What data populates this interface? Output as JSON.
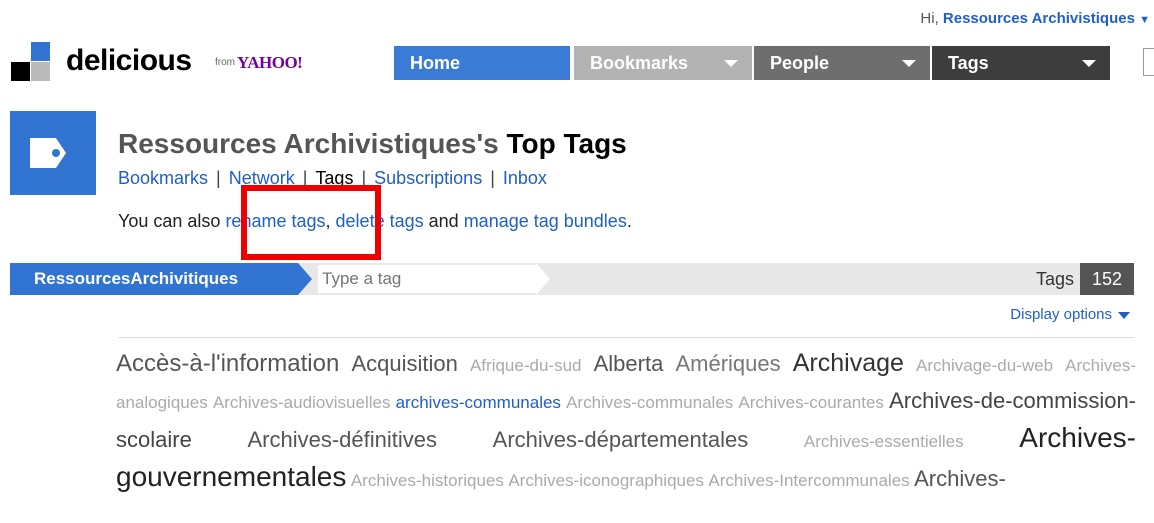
{
  "greeting": {
    "prefix": "Hi,",
    "user": "Ressources Archivistiques"
  },
  "logo": {
    "word": "delicious",
    "from": "from",
    "yahoo": "YAHOO!"
  },
  "nav": [
    {
      "label": "Home",
      "color": "#3a7bd5"
    },
    {
      "label": "Bookmarks",
      "color": "#b3b3b3"
    },
    {
      "label": "People",
      "color": "#6e6e6e"
    },
    {
      "label": "Tags",
      "color": "#3d3d3d"
    }
  ],
  "header": {
    "title_user": "Ressources Archivistiques's",
    "title_suffix": "Top Tags"
  },
  "subnav": {
    "bookmarks": "Bookmarks",
    "network": "Network",
    "tags": "Tags",
    "subscriptions": "Subscriptions",
    "inbox": "Inbox",
    "sep": "|"
  },
  "info": {
    "prefix": "You can also",
    "rename": "rename tags",
    "comma": ",",
    "delete": "delete tags",
    "and": "and",
    "manage": "manage tag bundles",
    "period": "."
  },
  "tagbar": {
    "user": "RessourcesArchivitiques",
    "placeholder": "Type a tag",
    "tags_label": "Tags",
    "count": "152"
  },
  "display_options": "Display options",
  "tag_cloud": [
    {
      "name": "Accès-à-l'information",
      "size": 24,
      "color": "#555"
    },
    {
      "name": "Acquisition",
      "size": 22,
      "color": "#555"
    },
    {
      "name": "Afrique-du-sud",
      "size": 17,
      "color": "#aaa"
    },
    {
      "name": "Alberta",
      "size": 22,
      "color": "#555"
    },
    {
      "name": "Amériques",
      "size": 22,
      "color": "#777"
    },
    {
      "name": "Archivage",
      "size": 25,
      "color": "#333"
    },
    {
      "name": "Archivage-du-web",
      "size": 17,
      "color": "#aaa"
    },
    {
      "name": "Archives-analogiques",
      "size": 17,
      "color": "#aaa"
    },
    {
      "name": "Archives-audiovisuelles",
      "size": 17,
      "color": "#aaa"
    },
    {
      "name": "archives-communales",
      "size": 17,
      "color": "#1f5fc8"
    },
    {
      "name": "Archives-communales",
      "size": 17,
      "color": "#aaa"
    },
    {
      "name": "Archives-courantes",
      "size": 17,
      "color": "#aaa"
    },
    {
      "name": "Archives-de-commission-scolaire",
      "size": 22,
      "color": "#444"
    },
    {
      "name": "Archives-définitives",
      "size": 22,
      "color": "#555"
    },
    {
      "name": "Archives-départementales",
      "size": 22,
      "color": "#555"
    },
    {
      "name": "Archives-essentielles",
      "size": 17,
      "color": "#aaa"
    },
    {
      "name": "Archives-gouvernementales",
      "size": 28,
      "color": "#222"
    },
    {
      "name": "Archives-historiques",
      "size": 17,
      "color": "#aaa"
    },
    {
      "name": "Archives-iconographiques",
      "size": 17,
      "color": "#aaa"
    },
    {
      "name": "Archives-Intercommunales",
      "size": 17,
      "color": "#aaa"
    },
    {
      "name": "Archives-",
      "size": 22,
      "color": "#555"
    }
  ]
}
